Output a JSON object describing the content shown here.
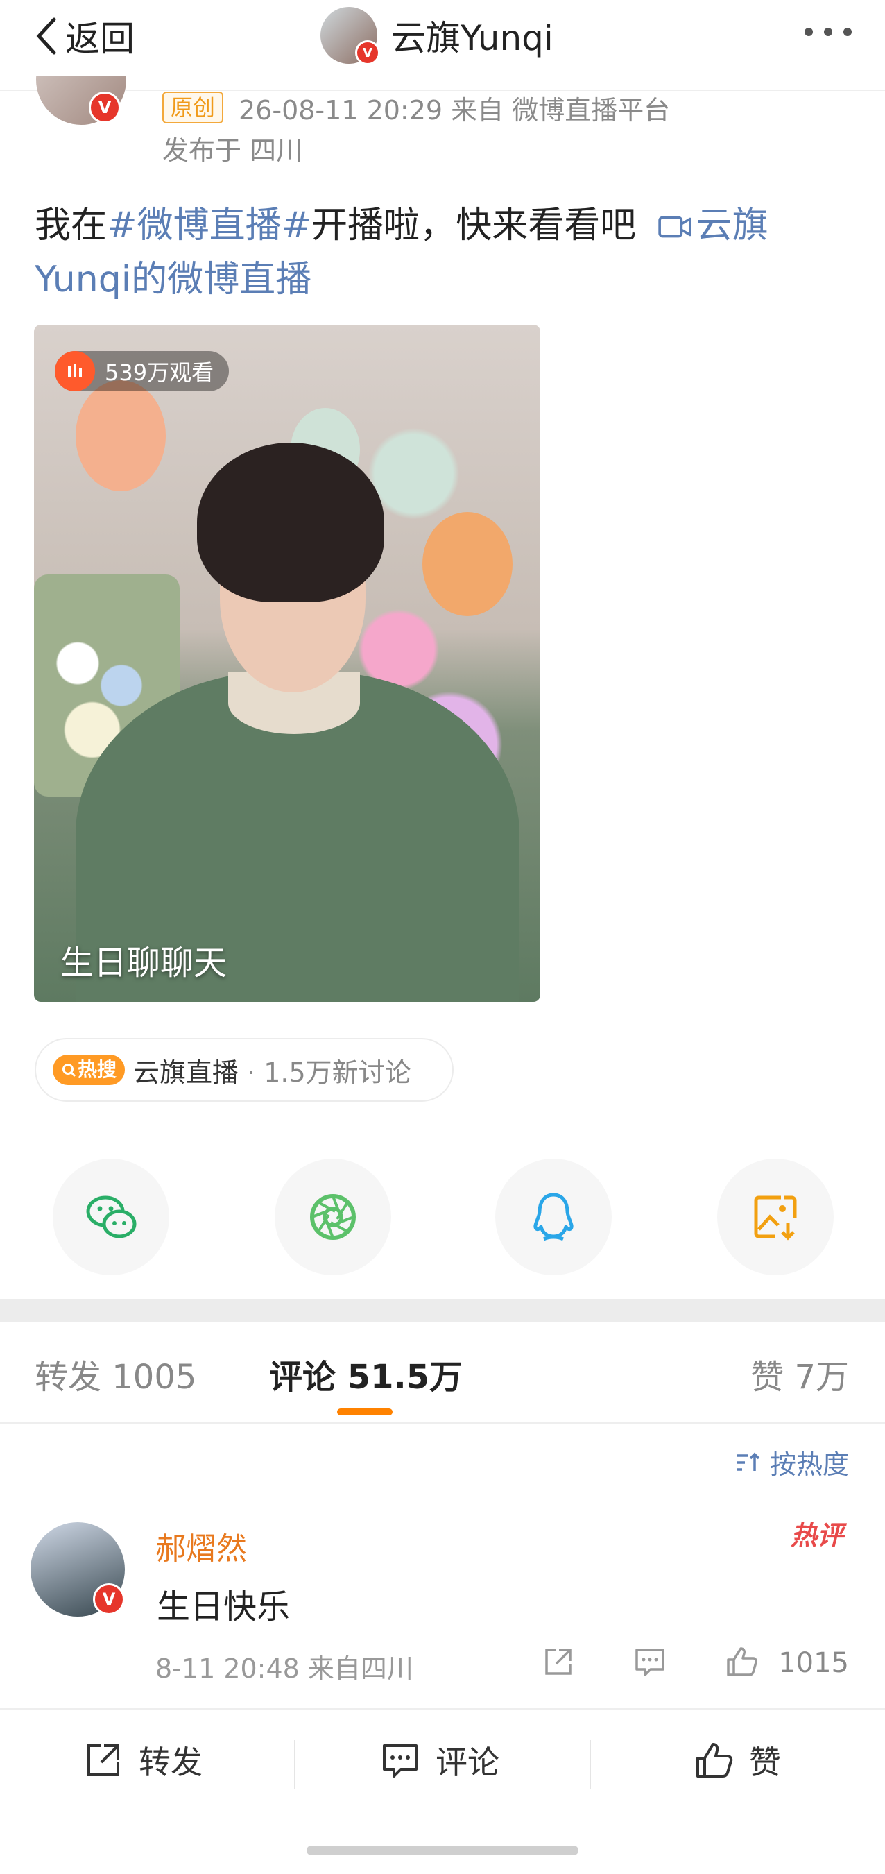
{
  "nav": {
    "back_label": "返回",
    "title": "云旗Yunqi",
    "verified_mark": "V"
  },
  "post": {
    "original_label": "原创",
    "meta_time_source": "26-08-11 20:29  来自 微博直播平台",
    "meta_location": "发布于 四川",
    "text_prefix": "我在",
    "hashtag": "#微博直播#",
    "text_middle": "开播啦，快来看看吧",
    "live_link": "云旗Yunqi的微博直播",
    "live_card": {
      "viewers": "539万观看",
      "title": "生日聊聊天"
    },
    "hot_search": {
      "tag": "热搜",
      "name": "云旗直播",
      "count": "· 1.5万新讨论"
    }
  },
  "share": {
    "items": [
      "wechat-icon",
      "moments-icon",
      "qq-icon",
      "save-image-icon"
    ],
    "colors": {
      "wechat": "#2aae67",
      "moments": "#5cc16a",
      "qq": "#2aa6e8",
      "save": "#f2a010"
    }
  },
  "tabs": {
    "repost": "转发 1005",
    "comment": "评论 51.5万",
    "like": "赞 7万"
  },
  "sort_label": "按热度",
  "comment": {
    "author": "郝熠然",
    "hot_badge": "热评",
    "text": "生日快乐",
    "time": "8-11 20:48 来自四川",
    "likes": "1015"
  },
  "toolbar": {
    "repost": "转发",
    "comment": "评论",
    "like": "赞"
  },
  "colors": {
    "link": "#5b7eb5",
    "accent": "#ff8200",
    "verified": "#e6362b"
  }
}
